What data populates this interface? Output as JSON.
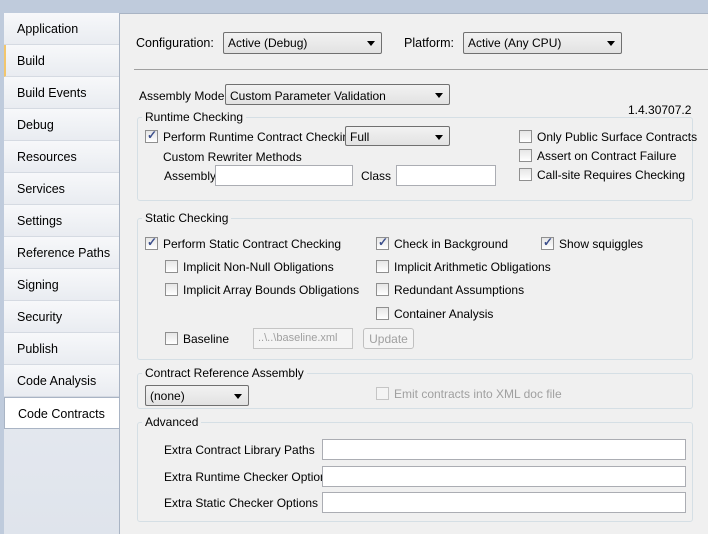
{
  "sidebar": {
    "items": [
      "Application",
      "Build",
      "Build Events",
      "Debug",
      "Resources",
      "Services",
      "Settings",
      "Reference Paths",
      "Signing",
      "Security",
      "Publish",
      "Code Analysis",
      "Code Contracts"
    ],
    "selected": "Code Contracts"
  },
  "header": {
    "configuration_label": "Configuration:",
    "configuration_value": "Active (Debug)",
    "platform_label": "Platform:",
    "platform_value": "Active (Any CPU)"
  },
  "assembly_mode": {
    "label": "Assembly Mode:",
    "value": "Custom Parameter Validation"
  },
  "version": "1.4.30707.2",
  "runtime": {
    "title": "Runtime Checking",
    "perform_label": "Perform Runtime Contract Checking",
    "perform_checked": true,
    "level": "Full",
    "rewriter_label": "Custom Rewriter Methods",
    "assembly_label": "Assembly",
    "assembly_value": "",
    "class_label": "Class",
    "class_value": "",
    "public_surface": "Only Public Surface Contracts",
    "assert_failure": "Assert on Contract Failure",
    "callsite": "Call-site Requires Checking"
  },
  "static": {
    "title": "Static Checking",
    "perform": "Perform Static Contract Checking",
    "non_null": "Implicit Non-Null Obligations",
    "array_bounds": "Implicit Array Bounds Obligations",
    "background": "Check in Background",
    "arithmetic": "Implicit Arithmetic Obligations",
    "redundant": "Redundant Assumptions",
    "container": "Container Analysis",
    "squiggles": "Show squiggles",
    "baseline": "Baseline",
    "baseline_path": "..\\..\\baseline.xml",
    "update": "Update"
  },
  "reference": {
    "title": "Contract Reference Assembly",
    "value": "(none)",
    "emit": "Emit contracts into XML doc file"
  },
  "advanced": {
    "title": "Advanced",
    "lib_paths": "Extra Contract Library Paths",
    "runtime_opts": "Extra Runtime Checker Options",
    "static_opts": "Extra Static Checker Options"
  }
}
